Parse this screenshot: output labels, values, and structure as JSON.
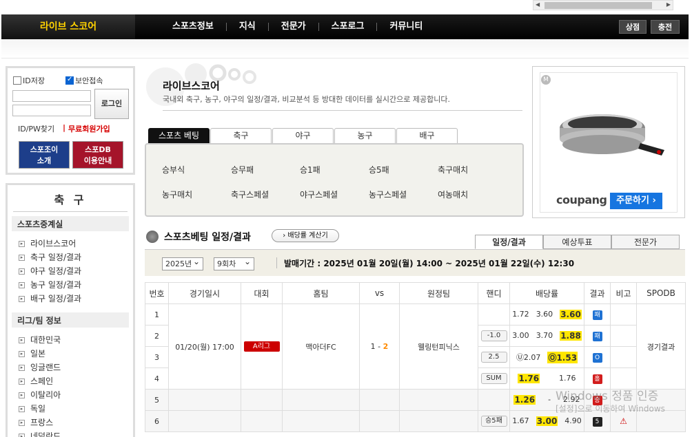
{
  "header": {
    "logo": "라이브 스코어",
    "nav": [
      "스포츠정보",
      "지식",
      "전문가",
      "스포로그",
      "커뮤니티"
    ],
    "shop_btn": "상점",
    "charge_btn": "충전"
  },
  "login": {
    "save_id": "ID저장",
    "secure": "보안접속",
    "login_btn": "로그인",
    "find": "ID/PW찾기",
    "sep": "|",
    "join": "무료회원가입",
    "btn1_l1": "스포조이",
    "btn1_l2": "소개",
    "btn2_l1": "스포DB",
    "btn2_l2": "이용안내",
    "btn1_color": "#1d3e8a",
    "btn2_color": "#a5142a"
  },
  "menu": {
    "title": "축 구",
    "sections": [
      {
        "title": "스포츠중계실",
        "items": [
          "라이브스코어",
          "축구 일정/결과",
          "야구 일정/결과",
          "농구 일정/결과",
          "배구 일정/결과"
        ]
      },
      {
        "title": "리그/팀 정보",
        "items": [
          "대한민국",
          "일본",
          "잉글랜드",
          "스페인",
          "이탈리아",
          "독일",
          "프랑스",
          "네덜란드"
        ]
      }
    ]
  },
  "center": {
    "title": "라이브스코어",
    "desc": "국내외 축구, 농구, 야구의 일정/결과, 비교분석 등 방대한 데이터를 실시간으로 제공합니다.",
    "tabs": [
      "스포츠 베팅",
      "축구",
      "야구",
      "농구",
      "배구"
    ],
    "links": [
      "승부식",
      "승무패",
      "승1패",
      "승5패",
      "축구매치",
      "농구매치",
      "축구스페셜",
      "야구스페셜",
      "농구스페셜",
      "여농매치"
    ]
  },
  "ad": {
    "m": "M",
    "brand": "coupang",
    "order": "주문하기 ›"
  },
  "betting": {
    "heading": "스포츠베팅 일정/결과",
    "calc": "› 배당률 계산기",
    "rtabs": [
      "일정/결과",
      "예상투표",
      "전문가"
    ],
    "year": "2025년",
    "round": "9회차",
    "period": "발매기간 : 2025년 01월 20일(월) 14:00 ~ 2025년 01월 22일(수) 12:30",
    "columns": [
      "번호",
      "경기일시",
      "대회",
      "홈팀",
      "vs",
      "원정팀",
      "핸디",
      "배당률",
      "결과",
      "비고",
      "SPODB"
    ],
    "match": {
      "date": "01/20(월) 17:00",
      "league": "A리그",
      "home": "맥아더FC",
      "score_home": "1",
      "score_sep": "-",
      "score_away": "2",
      "away": "웰링턴피닉스",
      "spodb": "경기결과"
    },
    "rows": [
      {
        "no": "1",
        "handi": "",
        "o1": "1.72",
        "o2": "3.60",
        "o3": "3.60",
        "hl": 3,
        "res": "패",
        "res_color": "blue"
      },
      {
        "no": "2",
        "handi": "-1.0",
        "o1": "3.00",
        "o2": "3.70",
        "o3": "1.88",
        "hl": 3,
        "res": "패",
        "res_color": "blue"
      },
      {
        "no": "3",
        "handi": "2.5",
        "o1": "Ⓤ2.07",
        "o2": "",
        "o3": "Ⓞ1.53",
        "hl": 3,
        "res": "O",
        "res_color": "blue"
      },
      {
        "no": "4",
        "handi": "SUM",
        "o1": "1.76",
        "o2": "",
        "o3": "1.76",
        "hl": 1,
        "res": "홀",
        "res_color": "red"
      },
      {
        "no": "5",
        "handi": "",
        "o1": "1.26",
        "o2": "-",
        "o3": "2.92",
        "hl": 1,
        "res": "승",
        "res_color": "red"
      },
      {
        "no": "6",
        "handi": "승5패",
        "o1": "1.67",
        "o2": "3.00",
        "o3": "4.90",
        "hl": 2,
        "res": "5",
        "res_color": "blk"
      }
    ],
    "row6_note": "⚠"
  },
  "watermark": {
    "line1": "Windows 정품 인증",
    "line2": "[설정]으로 이동하여 Windows"
  }
}
